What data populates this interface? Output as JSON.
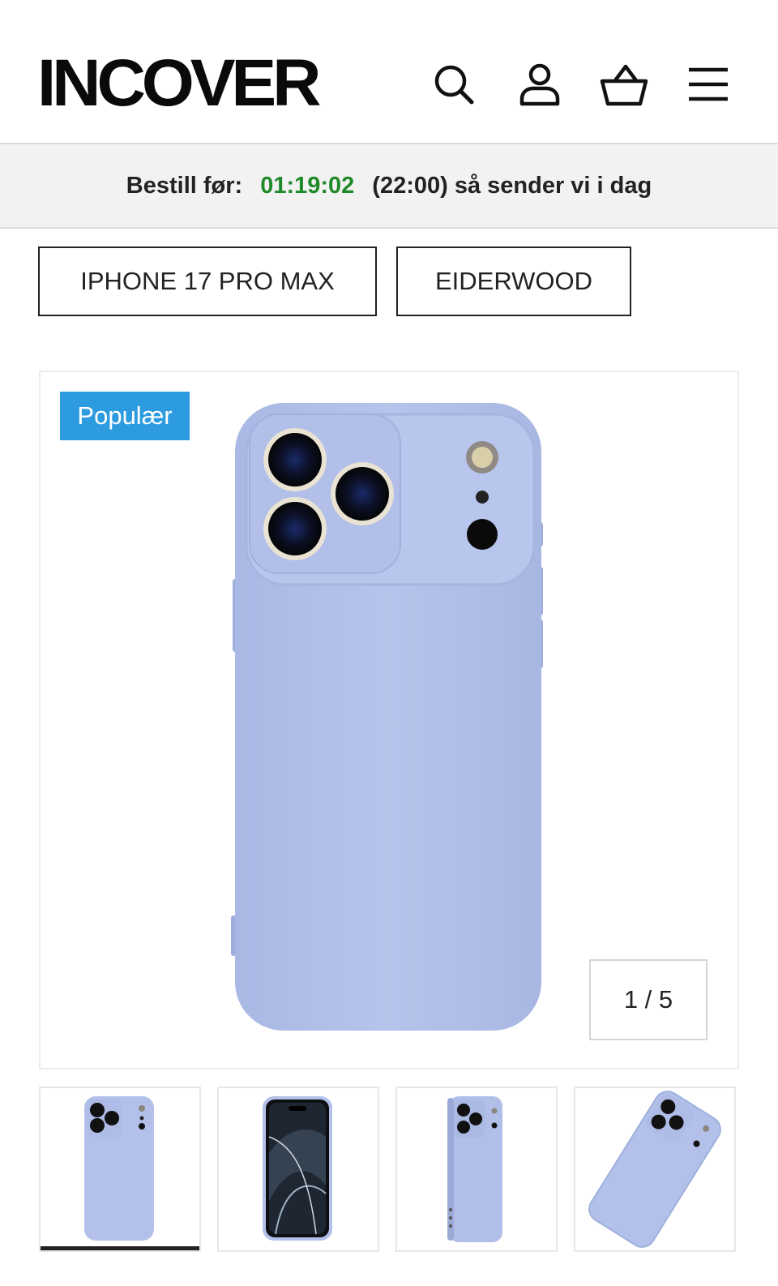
{
  "header": {
    "logo_text": "INCOVER",
    "icons": [
      "search-icon",
      "account-icon",
      "cart-icon",
      "menu-icon"
    ]
  },
  "banner": {
    "label": "Bestill før:",
    "countdown": "01:19:02",
    "suffix": "(22:00) så sender vi i dag",
    "countdown_color": "#1f8a2a"
  },
  "breadcrumbs": {
    "model": "IPHONE 17 PRO MAX",
    "brand": "EIDERWOOD"
  },
  "gallery": {
    "badge": "Populær",
    "badge_color": "#2d9be0",
    "counter": "1 / 5",
    "case_color": "#b3c1ea"
  },
  "thumbnails": [
    {
      "name": "back"
    },
    {
      "name": "front"
    },
    {
      "name": "side"
    },
    {
      "name": "angled"
    }
  ]
}
